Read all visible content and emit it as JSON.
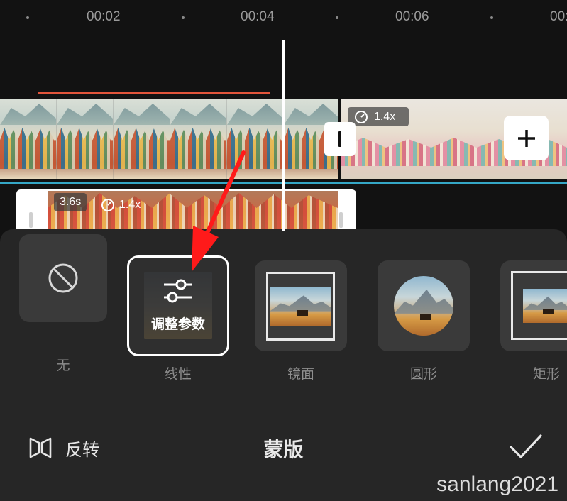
{
  "timeline": {
    "time_marks": [
      "00:02",
      "00:04",
      "00:06",
      "00:0"
    ],
    "main_clip_speed": "1.4x",
    "overlay_clip_duration": "3.6s",
    "overlay_clip_speed": "1.4x"
  },
  "mask_panel": {
    "title": "蒙版",
    "options": [
      {
        "label": "无",
        "icon": "prohibited-icon"
      },
      {
        "label": "线性",
        "icon": "sliders-icon",
        "selected": true,
        "overlay_text": "调整参数"
      },
      {
        "label": "镜面",
        "icon": "mirror-mask-icon"
      },
      {
        "label": "圆形",
        "icon": "circle-mask-icon"
      },
      {
        "label": "矩形",
        "icon": "rectangle-mask-icon"
      }
    ],
    "reverse_label": "反转",
    "confirm_icon": "checkmark-icon"
  },
  "watermark": "sanlang2021",
  "colors": {
    "background": "#121212",
    "panel": "#262626",
    "tile": "#3a3a3a",
    "accent_line": "#35a7c6",
    "annotation_arrow": "#ff1a1a",
    "marker_line": "#e2553b"
  }
}
